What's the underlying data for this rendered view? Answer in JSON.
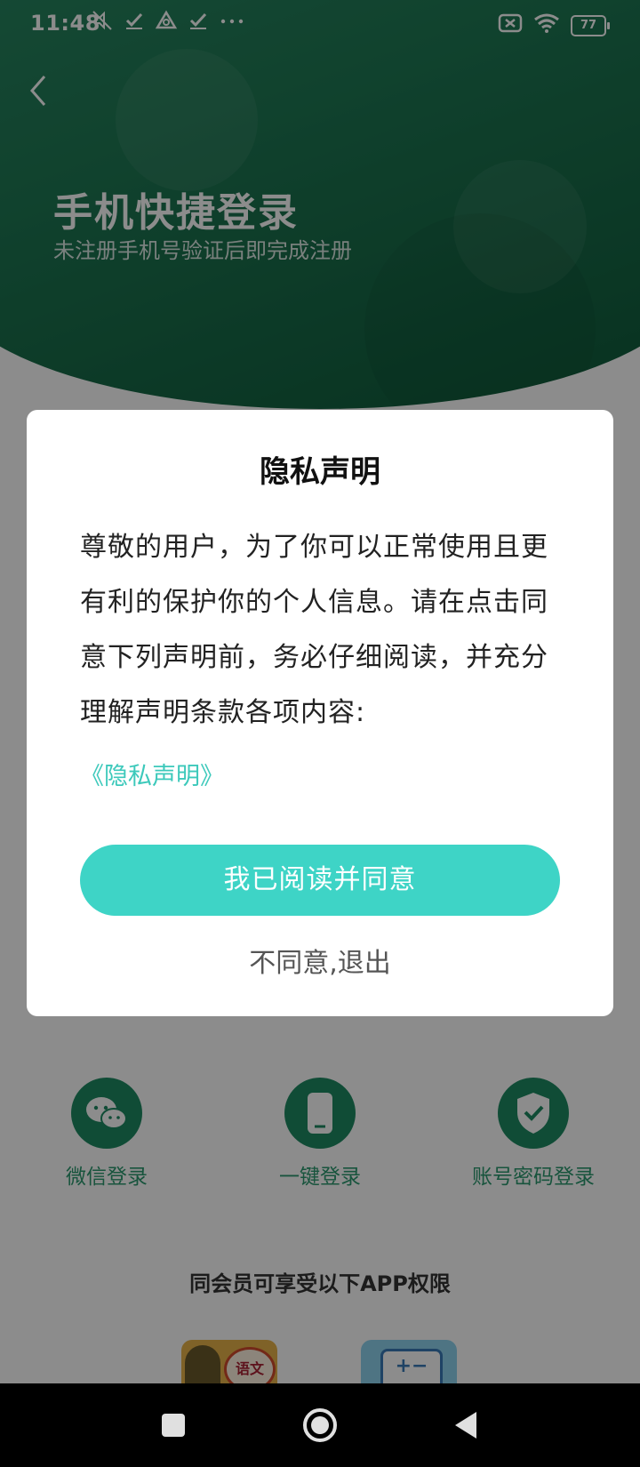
{
  "status_bar": {
    "time": "11:48",
    "battery": "77",
    "icons": [
      "mute-icon",
      "check-icon",
      "drive-icon",
      "check-icon",
      "more-icon",
      "sim-off-icon",
      "wifi-icon",
      "battery-icon"
    ]
  },
  "header": {
    "title": "手机快捷登录",
    "subtitle": "未注册手机号验证后即完成注册"
  },
  "dialog": {
    "title": "隐私声明",
    "body": "尊敬的用户，为了你可以正常使用且更有利的保护你的个人信息。请在点击同意下列声明前，务必仔细阅读，并充分理解声明条款各项内容:",
    "link": "《隐私声明》",
    "agree": "我已阅读并同意",
    "disagree": "不同意,退出"
  },
  "login_options": [
    {
      "label": "微信登录",
      "icon": "wechat-icon"
    },
    {
      "label": "一键登录",
      "icon": "phone-icon"
    },
    {
      "label": "账号密码登录",
      "icon": "shield-check-icon"
    }
  ],
  "permissions": {
    "title": "同会员可享受以下APP权限",
    "apps": [
      {
        "label": "语文",
        "icon": "chinese-app-icon"
      },
      {
        "label": "+−",
        "icon": "math-app-icon"
      }
    ]
  },
  "colors": {
    "accent": "#3ed4c6",
    "header_green": "#1f7a55",
    "option_green": "#1e8a63",
    "link": "#3dc9bb"
  }
}
